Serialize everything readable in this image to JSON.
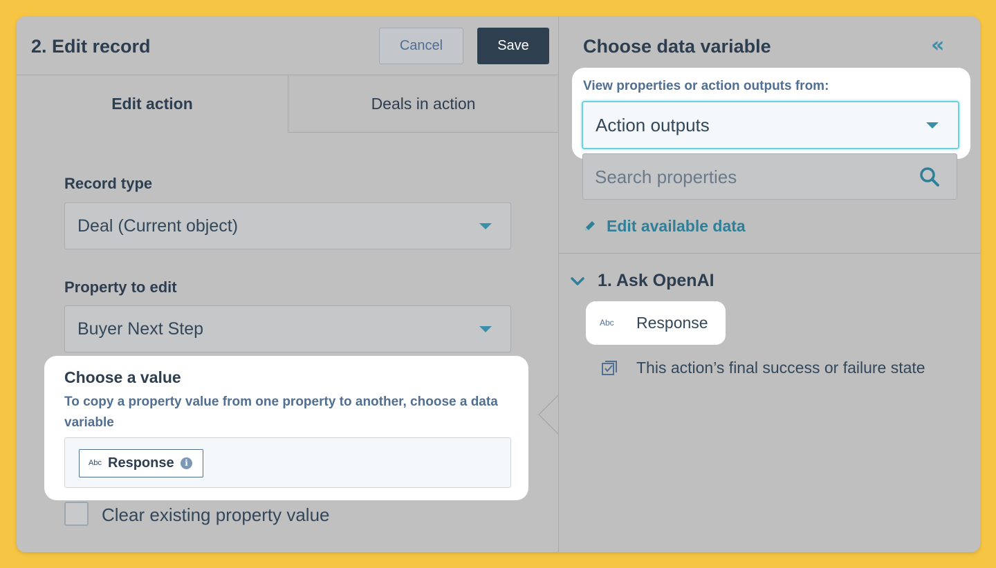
{
  "editor": {
    "title": "2. Edit record",
    "cancel_label": "Cancel",
    "save_label": "Save",
    "tabs": [
      {
        "label": "Edit action",
        "active": true
      },
      {
        "label": "Deals in action",
        "active": false
      }
    ],
    "record_type": {
      "label": "Record type",
      "value": "Deal (Current object)"
    },
    "property": {
      "label": "Property to edit",
      "value": "Buyer Next Step"
    },
    "choose_value": {
      "title": "Choose a value",
      "help": "To copy a property value from one property to another, choose a data variable",
      "token_type": "Abc",
      "token_label": "Response",
      "info_icon": "i"
    },
    "clear_existing": {
      "label": "Clear existing property value",
      "checked": false
    }
  },
  "variables": {
    "title": "Choose data variable",
    "collapse_icon": "«",
    "source_label": "View properties or action outputs from:",
    "source_value": "Action outputs",
    "search_placeholder": "Search properties",
    "edit_link": "Edit available data",
    "group": {
      "label": "1. Ask OpenAI",
      "items": [
        {
          "type": "Abc",
          "label": "Response"
        },
        {
          "type": "status",
          "label": "This action’s final success or failure state"
        }
      ]
    }
  },
  "colors": {
    "background": "#f7c544",
    "save_button": "#2e3f50",
    "accent": "#3b8fa8",
    "focus_border": "#6bd1e0"
  }
}
